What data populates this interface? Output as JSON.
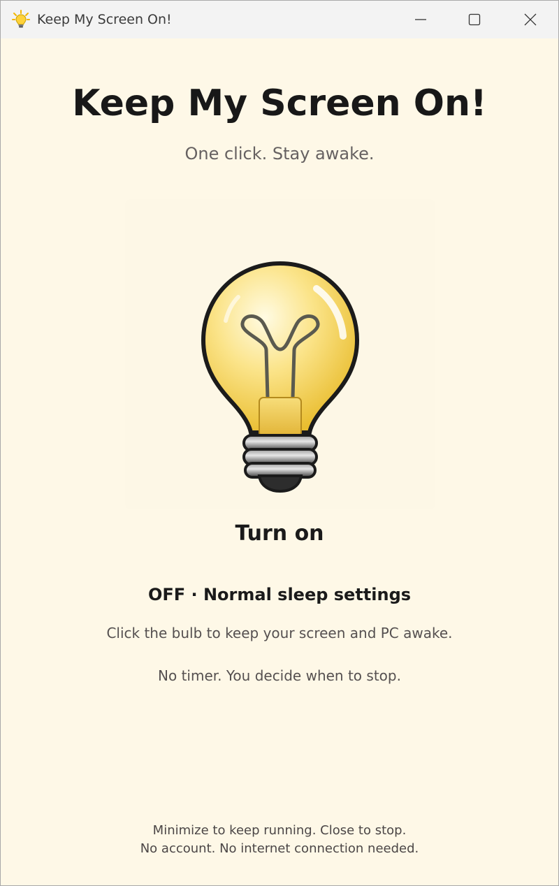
{
  "window": {
    "title": "Keep My Screen On!",
    "icon": "lightbulb-icon",
    "controls": {
      "minimize_icon": "minimize-icon",
      "maximize_icon": "maximize-icon",
      "close_icon": "close-icon"
    }
  },
  "main": {
    "title": "Keep My Screen On!",
    "subtitle": "One click. Stay awake.",
    "bulb_icon": "lightbulb-icon",
    "toggle_label": "Turn on",
    "status": "OFF · Normal sleep settings",
    "hint": "Click the bulb to keep your screen and PC awake.",
    "timer_note": "No timer. You decide when to stop."
  },
  "footer": {
    "line1": "Minimize to keep running. Close to stop.",
    "line2": "No account. No internet connection needed."
  },
  "colors": {
    "background": "#fef8e7",
    "titlebar": "#f3f3f3",
    "bulb_glass": "#f7d85a",
    "bulb_base": "#3a3a3a"
  }
}
